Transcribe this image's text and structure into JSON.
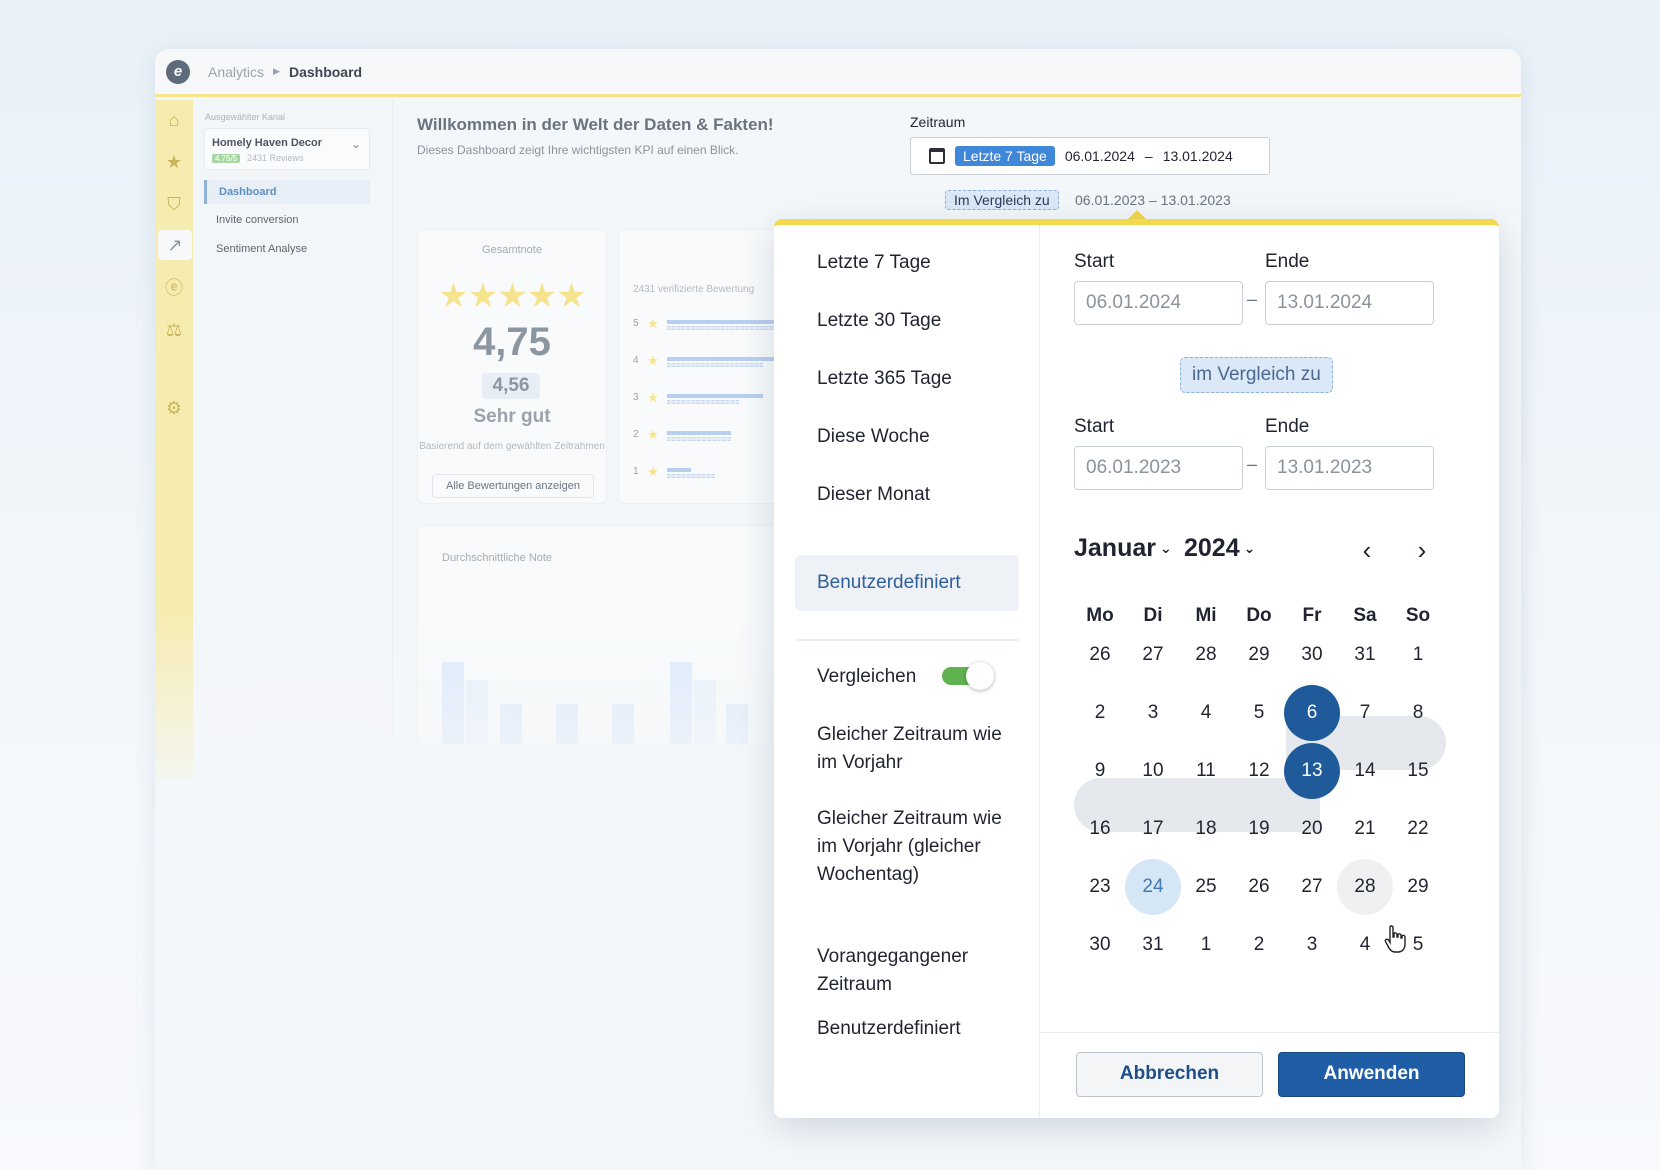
{
  "breadcrumb": {
    "parent": "Analytics",
    "current": "Dashboard"
  },
  "sidebar": {
    "channel_label": "Ausgewählter Kanal",
    "channel_name": "Homely Haven Decor",
    "channel_score": "4.75/5",
    "channel_reviews": "2431 Reviews",
    "nav": [
      "Dashboard",
      "Invite conversion",
      "Sentiment Analyse"
    ]
  },
  "header": {
    "title": "Willkommen in der Welt der Daten & Fakten!",
    "subtitle": "Dieses Dashboard zeigt Ihre wichtigsten KPI auf einen Blick."
  },
  "score_card": {
    "title": "Gesamtnote",
    "stars": "★★★★★",
    "score": "4,75",
    "prev_score": "4,56",
    "quality": "Sehr gut",
    "basis": "Basierend auf dem gewählten Zeitrahmen",
    "button": "Alle Bewertungen anzeigen"
  },
  "ratings_card": {
    "title": "2431 verifizierte Bewertung",
    "rows": [
      {
        "label": "5",
        "share": 0.9,
        "prev_share": 0.85
      },
      {
        "label": "4",
        "share": 0.75,
        "prev_share": 0.6
      },
      {
        "label": "3",
        "share": 0.6,
        "prev_share": 0.45
      },
      {
        "label": "2",
        "share": 0.4,
        "prev_share": 0.4
      },
      {
        "label": "1",
        "share": 0.15,
        "prev_share": 0.3
      }
    ]
  },
  "avg_card": {
    "title": "Durchschnittliche Note"
  },
  "zeitraum": {
    "label": "Zeitraum",
    "pill": "Letzte 7 Tage",
    "start": "06.01.2024",
    "sep": "–",
    "end": "13.01.2024",
    "compare_label": "Im Vergleich zu",
    "compare_start": "06.01.2023",
    "compare_end": "13.01.2023"
  },
  "picker": {
    "options": [
      "Letzte 7 Tage",
      "Letzte 30 Tage",
      "Letzte 365 Tage",
      "Diese Woche",
      "Dieser Monat",
      "Benutzerdefiniert"
    ],
    "compare_toggle_label": "Vergleichen",
    "compare_toggle_on": true,
    "compare_options": [
      "Gleicher Zeitraum wie im Vorjahr",
      "Gleicher Zeitraum wie im Vorjahr (gleicher Wochentag)",
      "Vorangegangener Zeitraum",
      "Benutzerdefiniert"
    ],
    "start_label": "Start",
    "end_label": "Ende",
    "start": "06.01.2024",
    "end": "13.01.2024",
    "compare_tag": "im Vergleich zu",
    "cmp_start": "06.01.2023",
    "cmp_end": "13.01.2023",
    "dash": "–",
    "month": "Januar",
    "year": "2024",
    "prev": "‹",
    "next": "›",
    "weekdays": [
      "Mo",
      "Di",
      "Mi",
      "Do",
      "Fr",
      "Sa",
      "So"
    ],
    "weeks": [
      [
        "26",
        "27",
        "28",
        "29",
        "30",
        "31",
        "1"
      ],
      [
        "2",
        "3",
        "4",
        "5",
        "6",
        "7",
        "8"
      ],
      [
        "9",
        "10",
        "11",
        "12",
        "13",
        "14",
        "15"
      ],
      [
        "16",
        "17",
        "18",
        "19",
        "20",
        "21",
        "22"
      ],
      [
        "23",
        "24",
        "25",
        "26",
        "27",
        "28",
        "29"
      ],
      [
        "30",
        "31",
        "1",
        "2",
        "3",
        "4",
        "5"
      ]
    ],
    "cancel": "Abbrechen",
    "apply": "Anwenden"
  }
}
